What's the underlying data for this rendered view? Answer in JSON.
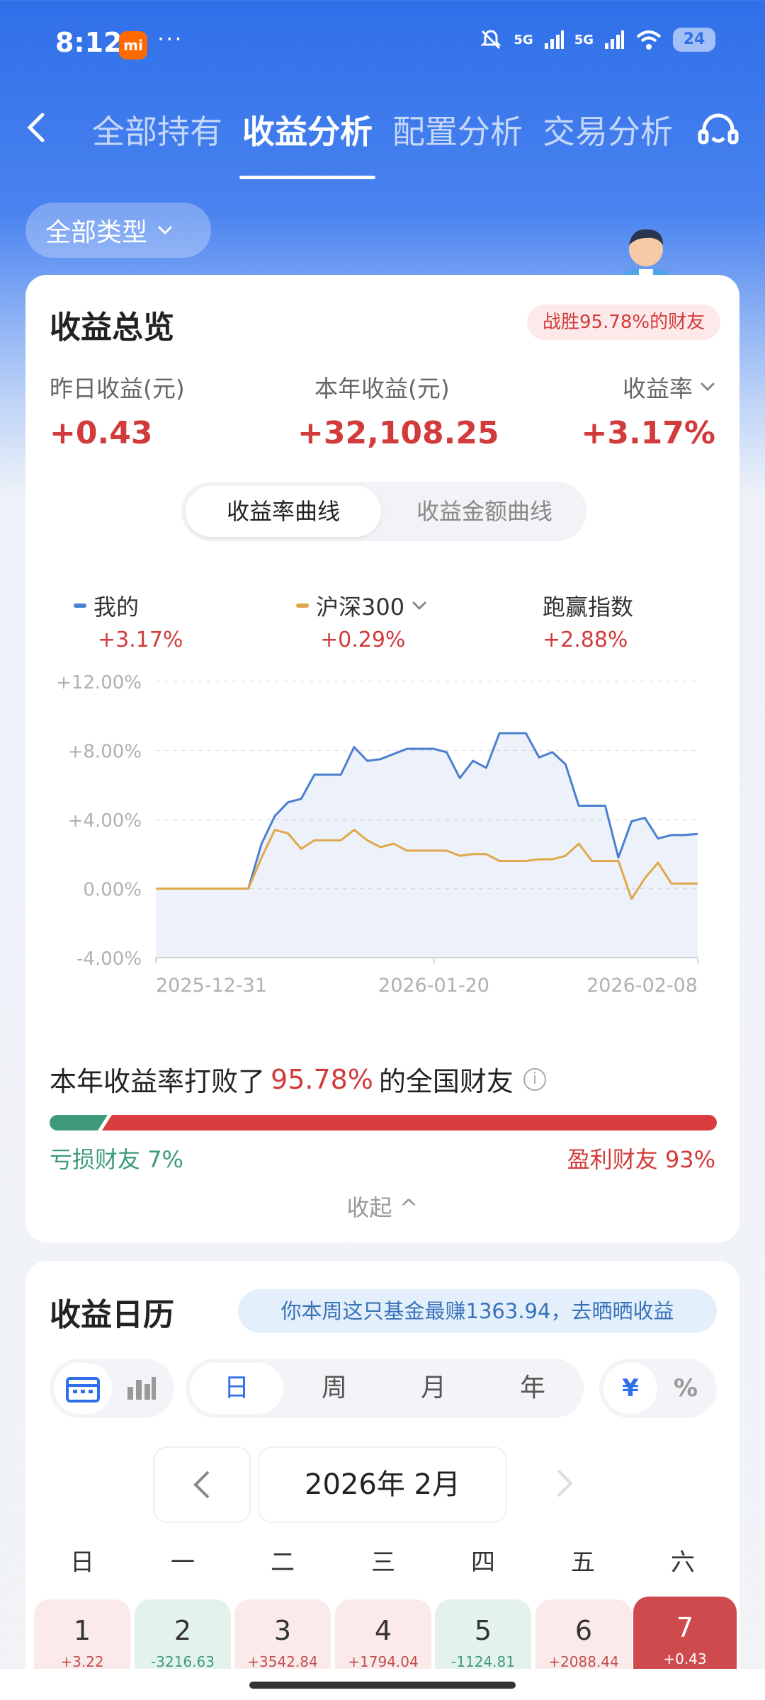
{
  "status": {
    "time": "8:12",
    "app_badge": "mi",
    "more": "···",
    "net1": "5G",
    "net2": "5G",
    "battery": "24"
  },
  "nav": {
    "tabs": [
      {
        "label": "全部持有"
      },
      {
        "label": "收益分析"
      },
      {
        "label": "配置分析"
      },
      {
        "label": "交易分析"
      }
    ],
    "active_tab": "收益分析"
  },
  "filter": {
    "label": "全部类型"
  },
  "overview": {
    "title": "收益总览",
    "badge": "战胜95.78%的财友",
    "stats": [
      {
        "label": "昨日收益(元)",
        "value": "+0.43"
      },
      {
        "label": "本年收益(元)",
        "value": "+32,108.25"
      },
      {
        "label": "收益率",
        "value": "+3.17%"
      }
    ],
    "curve_tabs": [
      "收益率曲线",
      "收益金额曲线"
    ],
    "legend": [
      {
        "name": "我的",
        "value": "+3.17%",
        "color": "#4a7fd0"
      },
      {
        "name": "沪深300",
        "value": "+0.29%",
        "color": "#e0a84a"
      },
      {
        "name": "跑赢指数",
        "value": "+2.88%"
      }
    ]
  },
  "chart_data": {
    "type": "line",
    "ylim": [
      -4,
      12
    ],
    "yticks": [
      "+12.00%",
      "+8.00%",
      "+4.00%",
      "0.00%",
      "-4.00%"
    ],
    "xticks": [
      "2025-12-31",
      "2026-01-20",
      "2026-02-08"
    ],
    "series": [
      {
        "name": "我的",
        "color": "#4a7fd0",
        "values": [
          0,
          0,
          0,
          0,
          0,
          0,
          0,
          0,
          2.6,
          4.2,
          5.0,
          5.2,
          6.6,
          6.6,
          6.6,
          8.2,
          7.4,
          7.5,
          7.8,
          8.1,
          8.1,
          8.1,
          7.9,
          6.4,
          7.4,
          7.0,
          9.0,
          9.0,
          9.0,
          7.6,
          7.9,
          7.2,
          4.8,
          4.8,
          4.8,
          1.8,
          3.9,
          4.1,
          2.9,
          3.1,
          3.1,
          3.17
        ]
      },
      {
        "name": "沪深300",
        "color": "#e0a84a",
        "values": [
          0,
          0,
          0,
          0,
          0,
          0,
          0,
          0,
          1.8,
          3.4,
          3.2,
          2.3,
          2.8,
          2.8,
          2.8,
          3.4,
          2.8,
          2.4,
          2.6,
          2.2,
          2.2,
          2.2,
          2.2,
          1.9,
          2.0,
          2.0,
          1.6,
          1.6,
          1.6,
          1.7,
          1.7,
          1.9,
          2.6,
          1.6,
          1.6,
          1.6,
          -0.6,
          0.6,
          1.5,
          0.3,
          0.29,
          0.29
        ]
      }
    ]
  },
  "beat": {
    "prefix": "本年收益率打败了",
    "percent": "95.78%",
    "suffix": "的全国财友",
    "loss_label": "亏损财友 7%",
    "win_label": "盈利财友 93%",
    "loss_share": 0.07,
    "collapse": "收起 ^"
  },
  "calendar": {
    "title": "收益日历",
    "tip": "你本周这只基金最赚1363.94，去晒晒收益",
    "periods": [
      "日",
      "周",
      "月",
      "年"
    ],
    "active_period": "日",
    "units": [
      "¥",
      "%"
    ],
    "month": "2026年 2月",
    "weekdays": [
      "日",
      "一",
      "二",
      "三",
      "四",
      "五",
      "六"
    ],
    "days": [
      {
        "num": "1",
        "val": "+3.22",
        "tone": "pink"
      },
      {
        "num": "2",
        "val": "-3216.63",
        "tone": "green"
      },
      {
        "num": "3",
        "val": "+3542.84",
        "tone": "pink"
      },
      {
        "num": "4",
        "val": "+1794.04",
        "tone": "pink"
      },
      {
        "num": "5",
        "val": "-1124.81",
        "tone": "green"
      },
      {
        "num": "6",
        "val": "+2088.44",
        "tone": "pink"
      },
      {
        "num": "7",
        "val": "+0.43",
        "tone": "selected"
      }
    ]
  }
}
